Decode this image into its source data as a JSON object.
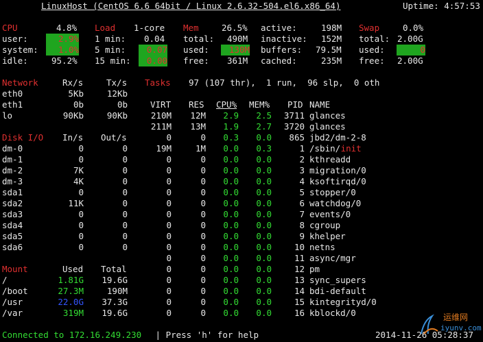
{
  "header": {
    "title": "LinuxHost (CentOS 6.6 64bit / Linux 2.6.32-504.el6.x86_64)",
    "uptime": "Uptime: 4:57:53"
  },
  "cpu": {
    "label": "CPU",
    "pct": "4.8%",
    "user_l": "user:",
    "user_v": "2.9%",
    "system_l": "system:",
    "system_v": "1.0%",
    "idle_l": "idle:",
    "idle_v": "95.2%"
  },
  "load": {
    "label": "Load",
    "cores": "1-core",
    "l1": "1 min:",
    "v1": "0.04",
    "l5": "5 min:",
    "v5": "0.07",
    "l15": "15 min:",
    "v15": "0.00"
  },
  "mem": {
    "label": "Mem",
    "pct": "26.5%",
    "total_l": "total:",
    "total_v": "490M",
    "used_l": "used:",
    "used_v": "130M",
    "free_l": "free:",
    "free_v": "361M",
    "active_l": "active:",
    "active_v": "198M",
    "inactive_l": "inactive:",
    "inactive_v": "152M",
    "buffers_l": "buffers:",
    "buffers_v": "79.5M",
    "cached_l": "cached:",
    "cached_v": "235M"
  },
  "swap": {
    "label": "Swap",
    "pct": "0.0%",
    "total_l": "total:",
    "total_v": "2.00G",
    "used_l": "used:",
    "used_v": "0",
    "free_l": "free:",
    "free_v": "2.00G"
  },
  "network": {
    "label": "Network",
    "rx": "Rx/s",
    "tx": "Tx/s",
    "rows": [
      [
        "eth0",
        "5Kb",
        "12Kb"
      ],
      [
        "eth1",
        "0b",
        "0b"
      ],
      [
        "lo",
        "90Kb",
        "90Kb"
      ]
    ]
  },
  "tasks": {
    "label": "Tasks",
    "summary": "97 (107 thr),  1 run,  96 slp,  0 oth"
  },
  "proc_header": {
    "virt": "VIRT",
    "res": "RES",
    "cpu": "CPU%",
    "mem": "MEM%",
    "pid": "PID",
    "name": "NAME"
  },
  "processes": [
    [
      "210M",
      "12M",
      "2.9",
      "2.5",
      "3711",
      "glances"
    ],
    [
      "211M",
      "13M",
      "1.9",
      "2.7",
      "3720",
      "glances"
    ],
    [
      "0",
      "0",
      "0.3",
      "0.0",
      "865",
      "jbd2/dm-2-8"
    ],
    [
      "19M",
      "1M",
      "0.0",
      "0.3",
      "1",
      "/sbin/",
      "init"
    ],
    [
      "0",
      "0",
      "0.0",
      "0.0",
      "2",
      "kthreadd"
    ],
    [
      "0",
      "0",
      "0.0",
      "0.0",
      "3",
      "migration/0"
    ],
    [
      "0",
      "0",
      "0.0",
      "0.0",
      "4",
      "ksoftirqd/0"
    ],
    [
      "0",
      "0",
      "0.0",
      "0.0",
      "5",
      "stopper/0"
    ],
    [
      "0",
      "0",
      "0.0",
      "0.0",
      "6",
      "watchdog/0"
    ],
    [
      "0",
      "0",
      "0.0",
      "0.0",
      "7",
      "events/0"
    ],
    [
      "0",
      "0",
      "0.0",
      "0.0",
      "8",
      "cgroup"
    ],
    [
      "0",
      "0",
      "0.0",
      "0.0",
      "9",
      "khelper"
    ],
    [
      "0",
      "0",
      "0.0",
      "0.0",
      "10",
      "netns"
    ],
    [
      "0",
      "0",
      "0.0",
      "0.0",
      "11",
      "async/mgr"
    ],
    [
      "0",
      "0",
      "0.0",
      "0.0",
      "12",
      "pm"
    ],
    [
      "0",
      "0",
      "0.0",
      "0.0",
      "13",
      "sync_supers"
    ],
    [
      "0",
      "0",
      "0.0",
      "0.0",
      "14",
      "bdi-default"
    ],
    [
      "0",
      "0",
      "0.0",
      "0.0",
      "15",
      "kintegrityd/0"
    ],
    [
      "0",
      "0",
      "0.0",
      "0.0",
      "16",
      "kblockd/0"
    ]
  ],
  "disk": {
    "label": "Disk I/O",
    "in": "In/s",
    "out": "Out/s",
    "rows": [
      [
        "dm-0",
        "0",
        "0"
      ],
      [
        "dm-1",
        "0",
        "0"
      ],
      [
        "dm-2",
        "7K",
        "0"
      ],
      [
        "dm-3",
        "4K",
        "0"
      ],
      [
        "sda1",
        "0",
        "0"
      ],
      [
        "sda2",
        "11K",
        "0"
      ],
      [
        "sda3",
        "0",
        "0"
      ],
      [
        "sda4",
        "0",
        "0"
      ],
      [
        "sda5",
        "0",
        "0"
      ],
      [
        "sda6",
        "0",
        "0"
      ]
    ]
  },
  "mount": {
    "label": "Mount",
    "used": "Used",
    "total": "Total",
    "rows": [
      [
        "/",
        "1.81G",
        "19.6G"
      ],
      [
        "/boot",
        "27.3M",
        "190M"
      ],
      [
        "/usr",
        "22.0G",
        "37.3G"
      ],
      [
        "/var",
        "319M",
        "19.6G"
      ]
    ]
  },
  "footer": {
    "connected": "Connected to 172.16.249.230",
    "help": " | Press 'h' for help",
    "date": "2014-11-26 05:28:37"
  },
  "watermark": {
    "text": "运维网",
    "sub": "iyunv.com"
  },
  "colors": {
    "red": "#e03030",
    "green": "#33dd33",
    "bar_green": "#1fa51f",
    "blue": "#3355ff"
  }
}
